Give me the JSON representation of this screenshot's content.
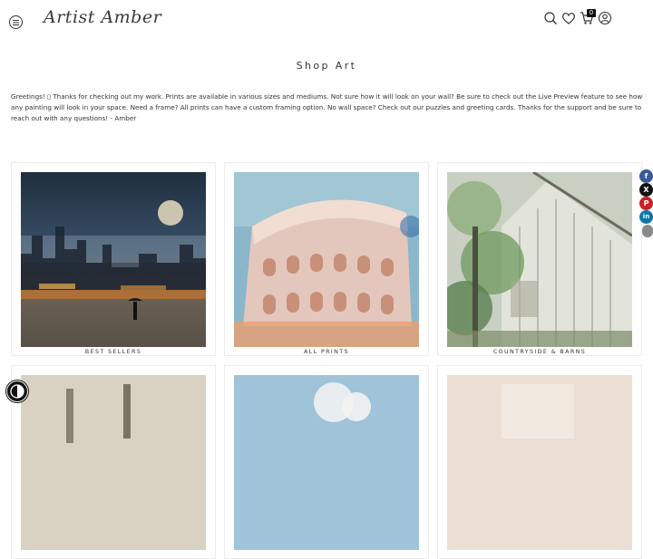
{
  "header": {
    "logo_text": "Artist Amber",
    "cart_count": "0",
    "icons": [
      "menu-icon",
      "search-icon",
      "heart-icon",
      "cart-icon",
      "account-icon"
    ]
  },
  "main": {
    "title": "Shop Art",
    "intro": "Greetings! ▯ Thanks for checking out my work. Prints are available in various sizes and mediums. Not sure how it will look on your wall? Be sure to check out the Live Preview feature to see how any painting will look in your space. Need a frame? All prints can have a custom framing option. No wall space? Check out our puzzles and greeting cards. Thanks for the support and be sure to reach out with any questions! - Amber",
    "collections": [
      {
        "label": "BEST SELLERS"
      },
      {
        "label": "ALL PRINTS"
      },
      {
        "label": "COUNTRYSIDE & BARNS"
      },
      {
        "label": ""
      },
      {
        "label": ""
      },
      {
        "label": ""
      }
    ]
  },
  "share": {
    "buttons": [
      {
        "icon": "facebook-icon",
        "glyph": "f",
        "color": "#3b5998"
      },
      {
        "icon": "x-icon",
        "glyph": "X",
        "color": "#111111"
      },
      {
        "icon": "pinterest-icon",
        "glyph": "P",
        "color": "#cb2027"
      },
      {
        "icon": "linkedin-icon",
        "glyph": "in",
        "color": "#0e76a8"
      }
    ]
  }
}
